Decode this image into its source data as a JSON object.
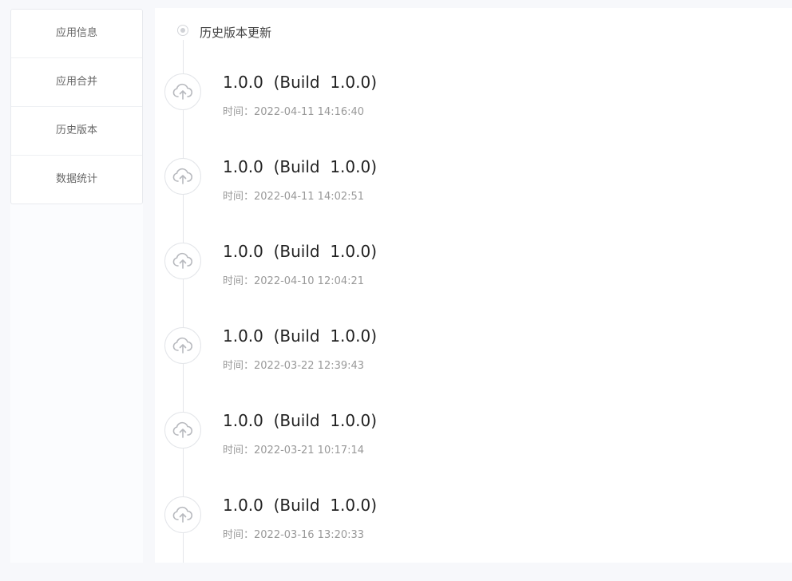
{
  "sidebar": {
    "items": [
      {
        "label": "应用信息"
      },
      {
        "label": "应用合并"
      },
      {
        "label": "历史版本"
      },
      {
        "label": "数据统计"
      }
    ]
  },
  "timeline": {
    "title": "历史版本更新",
    "icon": "cloud-upload-icon",
    "entries": [
      {
        "title": "1.0.0  (Build  1.0.0)",
        "time": "时间：2022-04-11 14:16:40"
      },
      {
        "title": "1.0.0  (Build  1.0.0)",
        "time": "时间：2022-04-11 14:02:51"
      },
      {
        "title": "1.0.0  (Build  1.0.0)",
        "time": "时间：2022-04-10 12:04:21"
      },
      {
        "title": "1.0.0  (Build  1.0.0)",
        "time": "时间：2022-03-22 12:39:43"
      },
      {
        "title": "1.0.0  (Build  1.0.0)",
        "time": "时间：2022-03-21 10:17:14"
      },
      {
        "title": "1.0.0  (Build  1.0.0)",
        "time": "时间：2022-03-16 13:20:33"
      }
    ]
  }
}
